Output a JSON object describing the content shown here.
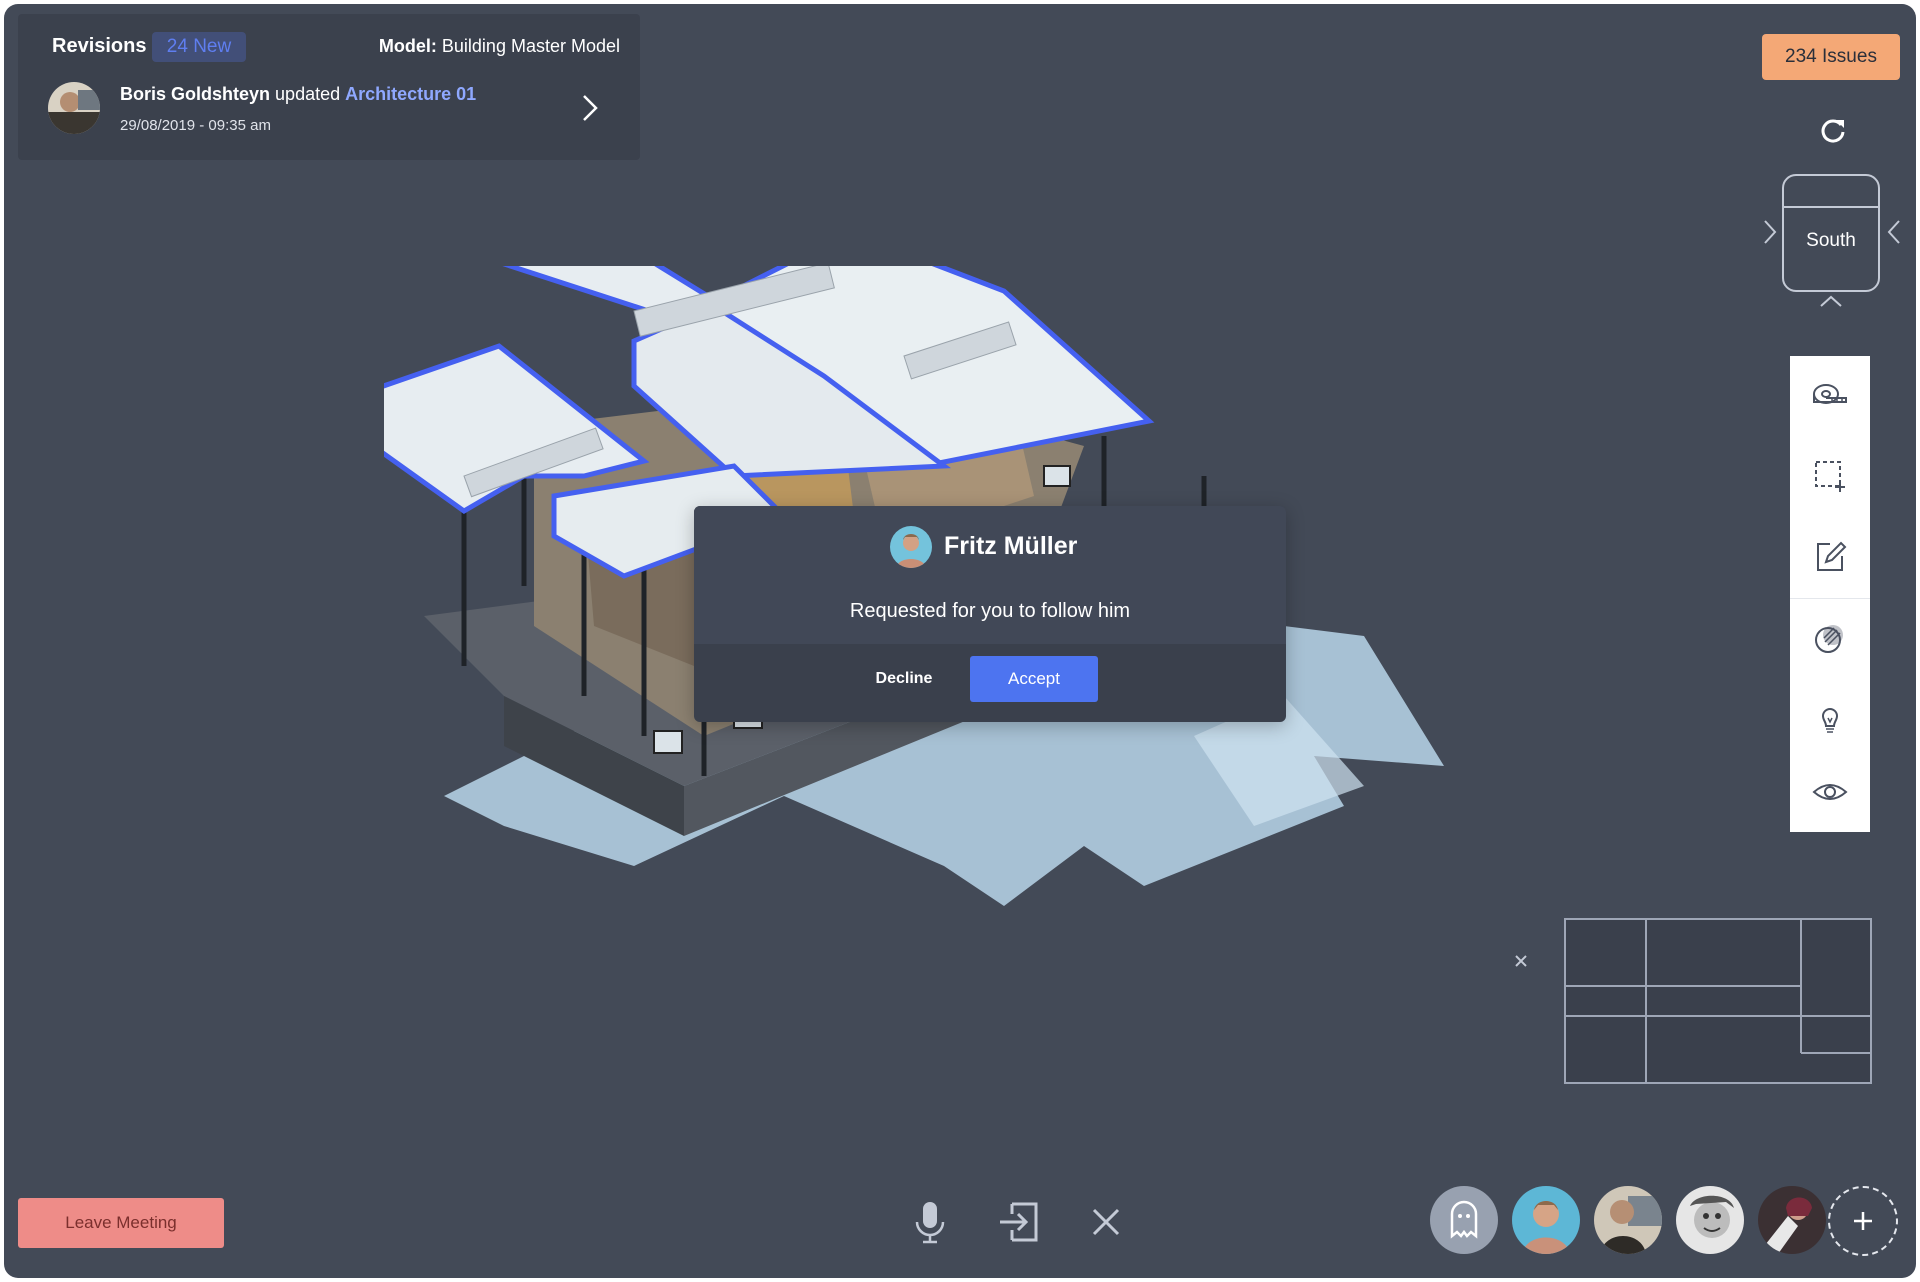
{
  "revisions": {
    "title": "Revisions",
    "badge": "24 New",
    "model_label": "Model:",
    "model_name": "Building Master Model",
    "user": "Boris Goldshteyn",
    "action": "updated",
    "target": "Architecture 01",
    "timestamp": "29/08/2019 - 09:35 am"
  },
  "issues": {
    "label": "234 Issues"
  },
  "view_cube": {
    "label": "South"
  },
  "tools": {
    "items": [
      "measure-tape-icon",
      "area-select-icon",
      "edit-markup-icon",
      "section-sphere-icon",
      "lightbulb-icon",
      "eye-icon"
    ]
  },
  "dialog": {
    "name": "Fritz Müller",
    "message": "Requested for you to follow him",
    "decline": "Decline",
    "accept": "Accept"
  },
  "bottom": {
    "leave": "Leave Meeting",
    "controls": [
      "microphone-icon",
      "enter-icon",
      "close-icon"
    ],
    "participants": [
      "ghost-avatar",
      "participant-1",
      "participant-2",
      "participant-3",
      "participant-4"
    ]
  },
  "colors": {
    "background": "#434a57",
    "panel": "#3b414d",
    "accent_blue": "#4d74f0",
    "link_blue": "#8fa8ff",
    "issues_orange": "#f4a876",
    "leave_red": "#ee8c88"
  }
}
